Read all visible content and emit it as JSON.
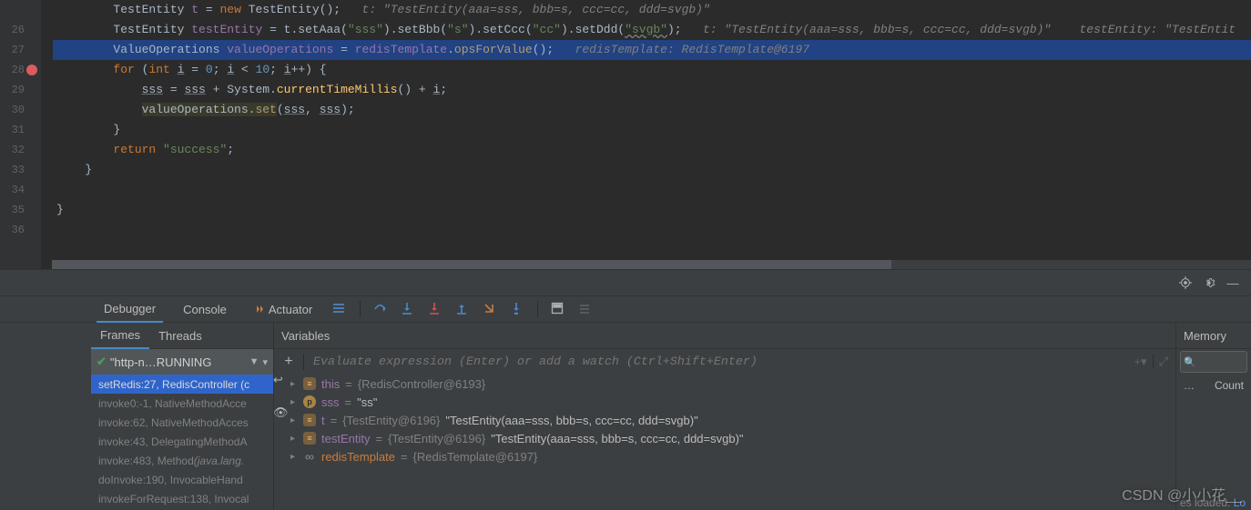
{
  "editor": {
    "lines": [
      {
        "n": "",
        "indent": 8,
        "segs": [
          [
            "typ",
            "TestEntity "
          ],
          [
            "var",
            "t"
          ],
          [
            "typ",
            " = "
          ],
          [
            "kw",
            "new "
          ],
          [
            "typ",
            "TestEntity();   "
          ],
          [
            "cmt",
            "t: \"TestEntity(aaa=sss, bbb=s, ccc=cc, ddd=svgb)\""
          ]
        ]
      },
      {
        "n": "26",
        "indent": 8,
        "segs": [
          [
            "typ",
            "TestEntity "
          ],
          [
            "var",
            "testEntity"
          ],
          [
            "typ",
            " = t.setAaa("
          ],
          [
            "str",
            "\"sss\""
          ],
          [
            "typ",
            ").setBbb("
          ],
          [
            "str",
            "\"s\""
          ],
          [
            "typ",
            ").setCcc("
          ],
          [
            "str",
            "\"cc\""
          ],
          [
            "typ",
            ").setDdd("
          ],
          [
            "wavy",
            "\"svgb\""
          ],
          [
            "typ",
            ");   "
          ],
          [
            "cmt",
            "t: \"TestEntity(aaa=sss, bbb=s, ccc=cc, ddd=svgb)\"    testEntity: \"TestEntit"
          ]
        ]
      },
      {
        "n": "27",
        "indent": 8,
        "cur": true,
        "segs": [
          [
            "typ",
            "ValueOperations "
          ],
          [
            "var",
            "valueOperations"
          ],
          [
            "typ",
            " = "
          ],
          [
            "field",
            "redisTemplate"
          ],
          [
            "typ",
            "."
          ],
          [
            "mtd",
            "opsForValue"
          ],
          [
            "typ",
            "();   "
          ],
          [
            "cmt",
            "redisTemplate: RedisTemplate@6197"
          ]
        ]
      },
      {
        "n": "28",
        "indent": 8,
        "segs": [
          [
            "kw",
            "for "
          ],
          [
            "typ",
            "("
          ],
          [
            "kw",
            "int "
          ],
          [
            "und",
            "i"
          ],
          [
            "typ",
            " = "
          ],
          [
            "num",
            "0"
          ],
          [
            "typ",
            "; "
          ],
          [
            "und",
            "i"
          ],
          [
            "typ",
            " < "
          ],
          [
            "num",
            "10"
          ],
          [
            "typ",
            "; "
          ],
          [
            "und",
            "i"
          ],
          [
            "typ",
            "++) {"
          ]
        ]
      },
      {
        "n": "29",
        "indent": 12,
        "segs": [
          [
            "und",
            "sss"
          ],
          [
            "typ",
            " = "
          ],
          [
            "und",
            "sss"
          ],
          [
            "typ",
            " + System."
          ],
          [
            "fn",
            "currentTimeMillis"
          ],
          [
            "typ",
            "() + "
          ],
          [
            "und",
            "i"
          ],
          [
            "typ",
            ";"
          ]
        ]
      },
      {
        "n": "30",
        "indent": 12,
        "segs": [
          [
            "hl",
            "valueOperations.set"
          ],
          [
            "typ",
            "("
          ],
          [
            "und",
            "sss"
          ],
          [
            "typ",
            ", "
          ],
          [
            "und",
            "sss"
          ],
          [
            "typ",
            ");"
          ]
        ]
      },
      {
        "n": "31",
        "indent": 8,
        "segs": [
          [
            "typ",
            "}"
          ]
        ]
      },
      {
        "n": "32",
        "indent": 8,
        "segs": [
          [
            "kw",
            "return "
          ],
          [
            "str",
            "\"success\""
          ],
          [
            "typ",
            ";"
          ]
        ]
      },
      {
        "n": "33",
        "indent": 4,
        "segs": [
          [
            "typ",
            "}"
          ]
        ]
      },
      {
        "n": "34",
        "indent": 0,
        "segs": []
      },
      {
        "n": "35",
        "indent": 0,
        "segs": [
          [
            "typ",
            "}"
          ]
        ]
      },
      {
        "n": "36",
        "indent": 0,
        "segs": []
      }
    ]
  },
  "toolbar": {
    "tab_debugger": "Debugger",
    "tab_console": "Console",
    "tab_actuator": "Actuator"
  },
  "frames": {
    "tab_frames": "Frames",
    "tab_threads": "Threads",
    "thread_label": "\"http-n…RUNNING",
    "items": [
      {
        "text": "setRedis:27, RedisController (c",
        "sel": true
      },
      {
        "text": "invoke0:-1, NativeMethodAcce"
      },
      {
        "text": "invoke:62, NativeMethodAcces"
      },
      {
        "text": "invoke:43, DelegatingMethodA"
      },
      {
        "text": "invoke:483, Method (java.lang."
      },
      {
        "text": "doInvoke:190, InvocableHand"
      },
      {
        "text": "invokeForRequest:138, Invocal"
      }
    ]
  },
  "vars": {
    "title": "Variables",
    "eval_placeholder": "Evaluate expression (Enter) or add a watch (Ctrl+Shift+Enter)",
    "rows": [
      {
        "badge": "eq",
        "name": "this",
        "val": "{RedisController@6193}",
        "str": ""
      },
      {
        "badge": "p",
        "name": "sss",
        "val": "",
        "str": "\"ss\""
      },
      {
        "badge": "eq",
        "name": "t",
        "val": "{TestEntity@6196} ",
        "str": "\"TestEntity(aaa=sss, bbb=s, ccc=cc, ddd=svgb)\""
      },
      {
        "badge": "eq",
        "name": "testEntity",
        "val": "{TestEntity@6196} ",
        "str": "\"TestEntity(aaa=sss, bbb=s, ccc=cc, ddd=svgb)\""
      },
      {
        "badge": "inf",
        "name": "redisTemplate",
        "nred": true,
        "val": "{RedisTemplate@6197}",
        "str": ""
      }
    ]
  },
  "memory": {
    "title": "Memory",
    "col_count": "Count",
    "footer_pre": "es loaded. ",
    "footer_link": "Lo",
    "dots": "…"
  },
  "watermark": "CSDN @小小花__"
}
